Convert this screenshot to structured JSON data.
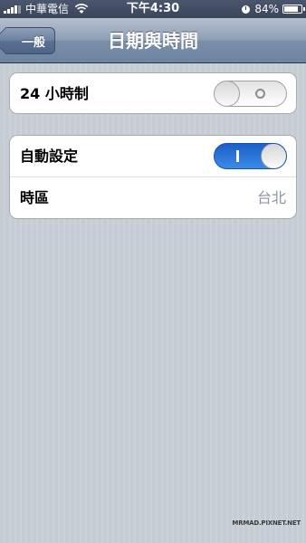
{
  "status_bar": {
    "carrier": "中華電信",
    "time": "下午4:30",
    "battery_text": "84%",
    "battery_level": 0.84,
    "icons": [
      "signal-bars-icon",
      "wifi-icon",
      "clock-icon",
      "battery-icon"
    ]
  },
  "nav": {
    "back_label": "一般",
    "title": "日期與時間"
  },
  "settings": {
    "hour24": {
      "label": "24 小時制",
      "on": false
    },
    "auto_set": {
      "label": "自動設定",
      "on": true
    },
    "timezone": {
      "label": "時區",
      "value": "台北"
    }
  },
  "watermark": "MRMAD.PIXNET.NET",
  "colors": {
    "switch_on": "#1a60c8",
    "value_text": "#8a95a8",
    "nav_bar": "#8d9eb4"
  }
}
